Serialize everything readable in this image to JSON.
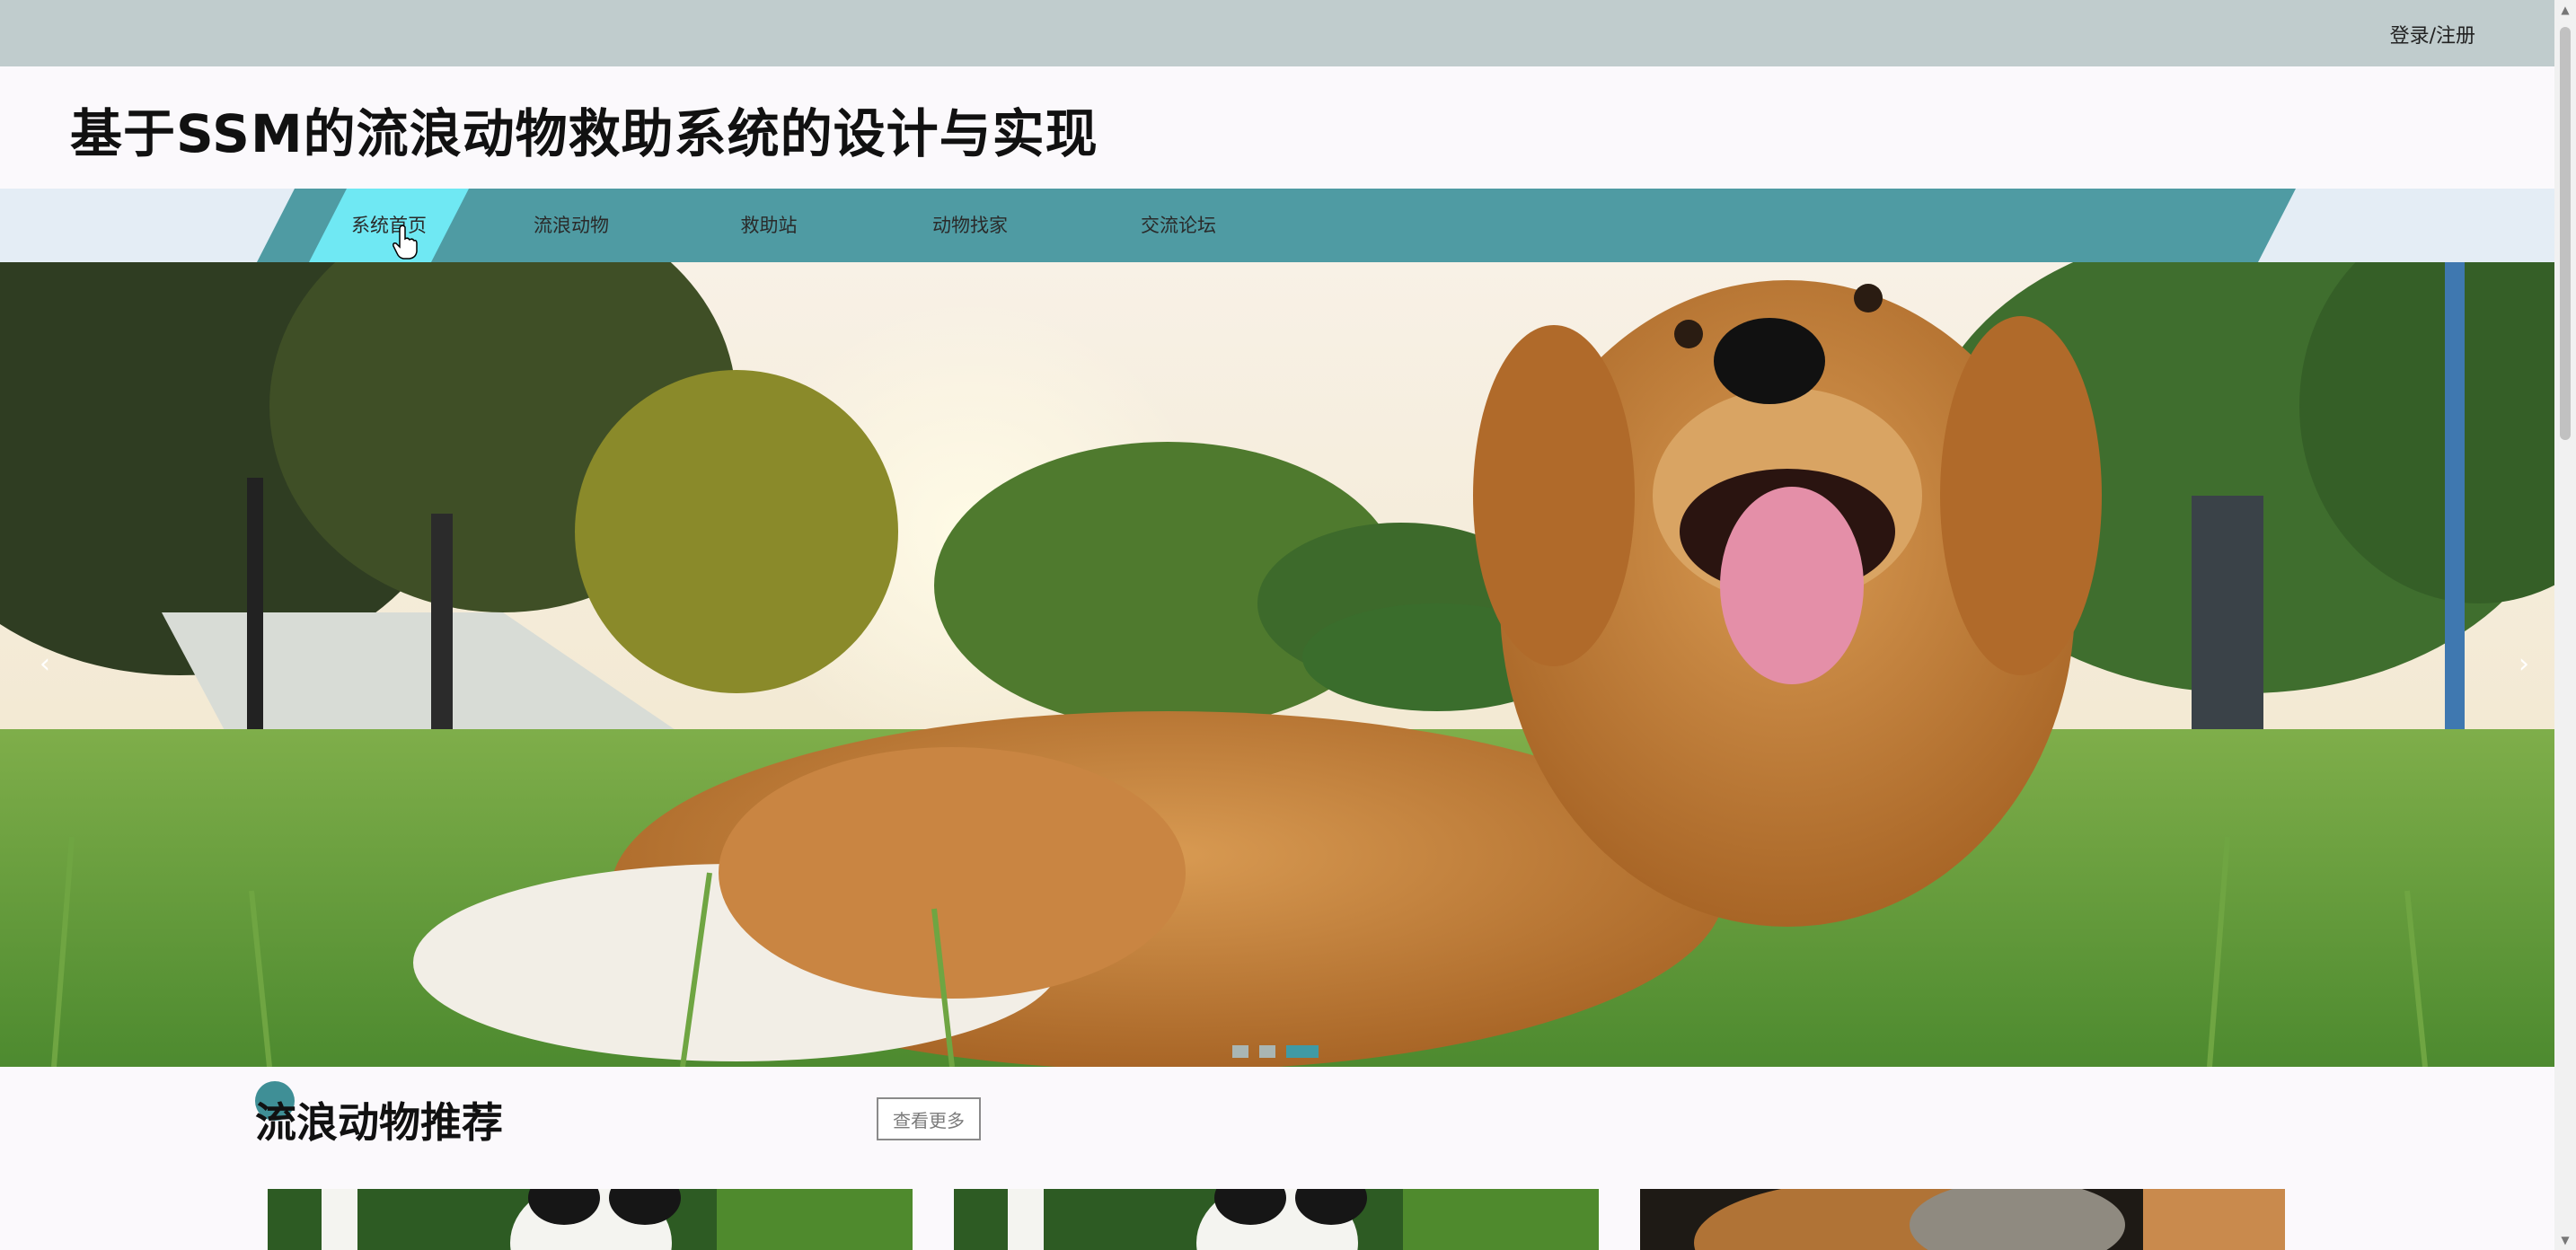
{
  "top_bar": {
    "login_link": "登录/注册"
  },
  "header": {
    "title": "基于SSM的流浪动物救助系统的设计与实现"
  },
  "nav": {
    "items": [
      {
        "label": "系统首页",
        "active": true
      },
      {
        "label": "流浪动物",
        "active": false
      },
      {
        "label": "救助站",
        "active": false
      },
      {
        "label": "动物找家",
        "active": false
      },
      {
        "label": "交流论坛",
        "active": false
      }
    ]
  },
  "carousel": {
    "image": "golden-retriever-on-grass",
    "prev_icon": "chevron-left-icon",
    "next_icon": "chevron-right-icon",
    "prev_glyph": "‹",
    "next_glyph": "›",
    "slide_count": 3,
    "active_slide": 3
  },
  "recommend": {
    "title": "流浪动物推荐",
    "more_label": "查看更多",
    "cards": [
      {
        "image": "panda-bamboo"
      },
      {
        "image": "panda-bamboo"
      },
      {
        "image": "brown-dog"
      }
    ]
  },
  "colors": {
    "top_bar": "#c0cccd",
    "nav_band": "#4f9ba3",
    "nav_active": "#6fe8f3",
    "accent": "#3f8f96"
  }
}
